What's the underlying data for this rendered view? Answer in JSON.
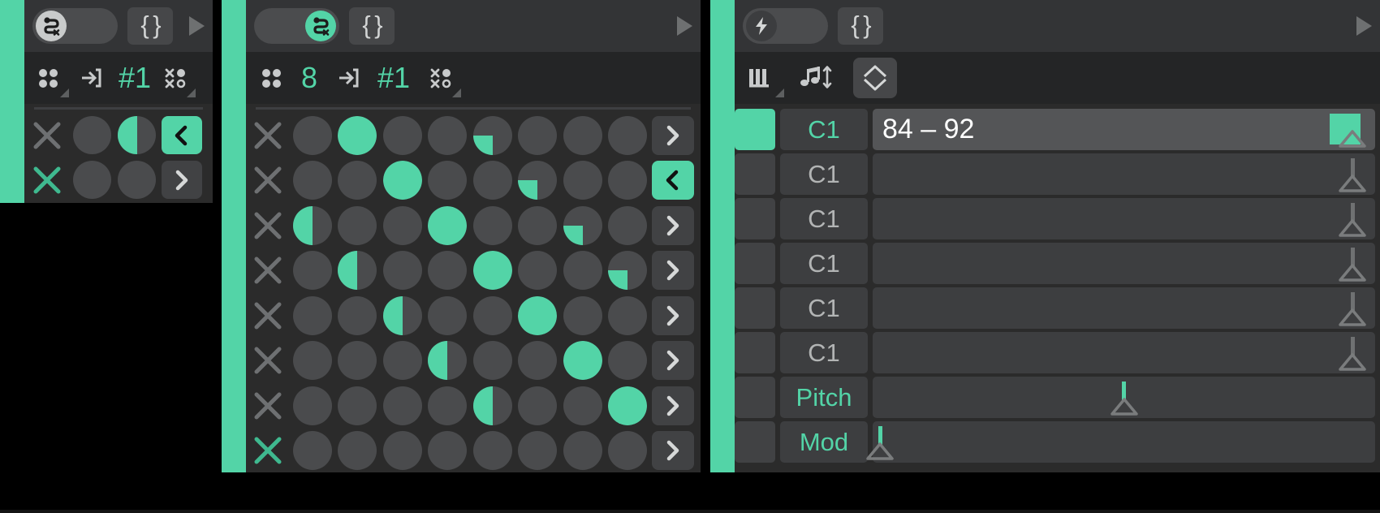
{
  "app": {
    "accent_color": "#53d4a7",
    "bg_color": "#000000",
    "panel_color": "#2b2b2b"
  },
  "left_panel": {
    "header": {
      "toggle": {
        "icon": "snake-x-icon",
        "state": "off",
        "knob_side": "left"
      },
      "braces_button": {
        "label": "{ }",
        "icon": "braces-icon"
      },
      "play_button": {
        "icon": "play-triangle-icon"
      }
    },
    "toolbar": [
      {
        "icon": "four-dots-icon",
        "label": "",
        "has_corner": true
      },
      {
        "icon": "enter-arrow-icon",
        "label": "",
        "has_corner": false
      },
      {
        "icon": "hash-number-icon",
        "label": "#1",
        "has_corner": true
      },
      {
        "icon": "x-dots-icon",
        "label": "",
        "has_corner": true
      }
    ],
    "rows": [
      {
        "x": "x-grey",
        "cells": [
          "empty",
          "half"
        ],
        "arrow": {
          "dir": "left",
          "active": true
        }
      },
      {
        "x": "x-green",
        "cells": [
          "empty",
          "empty"
        ],
        "arrow": {
          "dir": "right",
          "active": false
        }
      }
    ]
  },
  "middle_panel": {
    "header": {
      "toggle": {
        "icon": "snake-x-icon",
        "state": "on",
        "knob_side": "right"
      },
      "braces_button": {
        "label": "{ }",
        "icon": "braces-icon"
      },
      "play_button": {
        "icon": "play-triangle-icon"
      }
    },
    "toolbar": [
      {
        "icon": "four-dots-icon",
        "label": "",
        "has_corner": false
      },
      {
        "icon": "step-count",
        "label": "8",
        "has_corner": true
      },
      {
        "icon": "enter-arrow-icon",
        "label": "",
        "has_corner": false
      },
      {
        "icon": "hash-number-icon",
        "label": "#1",
        "has_corner": true
      },
      {
        "icon": "x-dots-icon",
        "label": "",
        "has_corner": true
      }
    ],
    "grid": {
      "columns": 8,
      "rows": [
        {
          "x": "x-grey",
          "cells": [
            "empty",
            "full",
            "empty",
            "empty",
            "quarter",
            "empty",
            "empty",
            "empty"
          ],
          "arrow": {
            "dir": "right",
            "active": false
          }
        },
        {
          "x": "x-grey",
          "cells": [
            "empty",
            "empty",
            "full",
            "empty",
            "empty",
            "quarter",
            "empty",
            "empty"
          ],
          "arrow": {
            "dir": "left",
            "active": true
          }
        },
        {
          "x": "x-grey",
          "cells": [
            "half",
            "empty",
            "empty",
            "full",
            "empty",
            "empty",
            "quarter",
            "empty"
          ],
          "arrow": {
            "dir": "right",
            "active": false
          }
        },
        {
          "x": "x-grey",
          "cells": [
            "empty",
            "half",
            "empty",
            "empty",
            "full",
            "empty",
            "empty",
            "quarter"
          ],
          "arrow": {
            "dir": "right",
            "active": false
          }
        },
        {
          "x": "x-grey",
          "cells": [
            "empty",
            "empty",
            "half",
            "empty",
            "empty",
            "full",
            "empty",
            "empty"
          ],
          "arrow": {
            "dir": "right",
            "active": false
          }
        },
        {
          "x": "x-grey",
          "cells": [
            "empty",
            "empty",
            "empty",
            "half",
            "empty",
            "empty",
            "full",
            "empty"
          ],
          "arrow": {
            "dir": "right",
            "active": false
          }
        },
        {
          "x": "x-grey",
          "cells": [
            "empty",
            "empty",
            "empty",
            "empty",
            "half",
            "empty",
            "empty",
            "full"
          ],
          "arrow": {
            "dir": "right",
            "active": false
          }
        },
        {
          "x": "x-green",
          "cells": [
            "empty",
            "empty",
            "empty",
            "empty",
            "empty",
            "empty",
            "empty",
            "empty"
          ],
          "arrow": {
            "dir": "right",
            "active": false
          }
        }
      ]
    }
  },
  "right_panel": {
    "header": {
      "toggle": {
        "icon": "lightning-bolt-icon",
        "state": "off",
        "knob_side": "left"
      },
      "braces_button": {
        "label": "{ }",
        "icon": "braces-icon"
      },
      "play_button": {
        "icon": "play-triangle-icon"
      }
    },
    "toolbar": [
      {
        "icon": "piano-keys-icon",
        "label": "",
        "has_corner": true,
        "boxed": false
      },
      {
        "icon": "note-updown-icon",
        "label": "",
        "has_corner": false,
        "boxed": false
      },
      {
        "icon": "diamond-chevron-icon",
        "label": "",
        "has_corner": false,
        "boxed": true
      }
    ],
    "lanes": [
      {
        "checked": true,
        "label": "C1",
        "label_green": true,
        "value": "84 – 92",
        "active": true,
        "swatch_pct": 91,
        "handle_pct": 95.5,
        "handle_stem": false,
        "stem_color": "grey"
      },
      {
        "checked": false,
        "label": "C1",
        "label_green": false,
        "value": "",
        "active": false,
        "swatch_pct": null,
        "handle_pct": 95.5,
        "handle_stem": true,
        "stem_color": "grey"
      },
      {
        "checked": false,
        "label": "C1",
        "label_green": false,
        "value": "",
        "active": false,
        "swatch_pct": null,
        "handle_pct": 95.5,
        "handle_stem": true,
        "stem_color": "grey"
      },
      {
        "checked": false,
        "label": "C1",
        "label_green": false,
        "value": "",
        "active": false,
        "swatch_pct": null,
        "handle_pct": 95.5,
        "handle_stem": true,
        "stem_color": "grey"
      },
      {
        "checked": false,
        "label": "C1",
        "label_green": false,
        "value": "",
        "active": false,
        "swatch_pct": null,
        "handle_pct": 95.5,
        "handle_stem": true,
        "stem_color": "grey"
      },
      {
        "checked": false,
        "label": "C1",
        "label_green": false,
        "value": "",
        "active": false,
        "swatch_pct": null,
        "handle_pct": 95.5,
        "handle_stem": true,
        "stem_color": "grey"
      },
      {
        "checked": false,
        "label": "Pitch",
        "label_green": true,
        "value": "",
        "active": false,
        "swatch_pct": null,
        "handle_pct": 50.0,
        "handle_stem": true,
        "stem_color": "green"
      },
      {
        "checked": false,
        "label": "Mod",
        "label_green": true,
        "value": "",
        "active": false,
        "swatch_pct": null,
        "handle_pct": 1.5,
        "handle_stem": true,
        "stem_color": "green"
      }
    ]
  }
}
